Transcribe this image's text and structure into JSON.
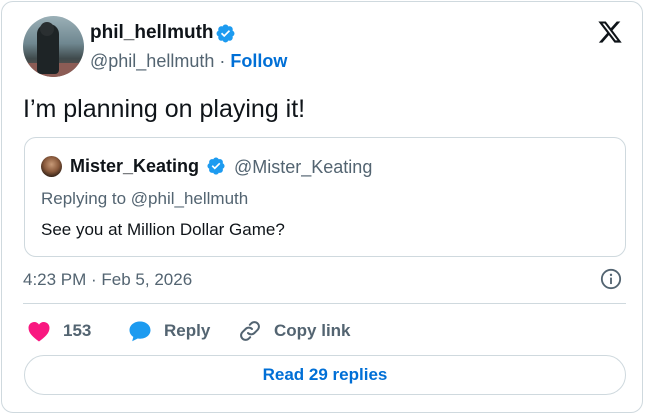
{
  "author": {
    "name": "phil_hellmuth",
    "handle": "@phil_hellmuth",
    "separator": " · ",
    "follow_label": "Follow",
    "verified": true
  },
  "tweet": {
    "text": "I’m planning on playing it!",
    "timestamp": "4:23 PM · Feb 5, 2026"
  },
  "quote": {
    "name": "Mister_Keating",
    "handle": "@Mister_Keating",
    "replying_to": "Replying to @phil_hellmuth",
    "text": "See you at Million Dollar Game?",
    "verified": true
  },
  "actions": {
    "likes_count": "153",
    "reply_label": "Reply",
    "copy_label": "Copy link",
    "read_replies_label": "Read 29 replies"
  },
  "colors": {
    "link": "#006fd6",
    "verified": "#1d9bf0",
    "like": "#f91880",
    "secondary_text": "#536471",
    "border": "#cfd9de"
  },
  "icons": {
    "logo": "x-logo-icon",
    "verified": "verified-badge-icon",
    "info": "info-icon",
    "like": "heart-icon",
    "reply": "speech-bubble-icon",
    "copy": "link-icon"
  }
}
